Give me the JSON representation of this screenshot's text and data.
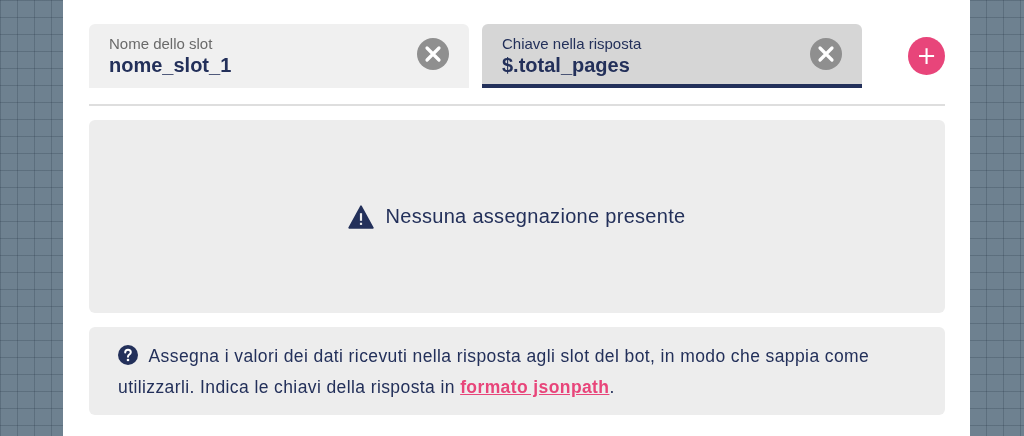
{
  "fields": [
    {
      "label": "Nome dello slot",
      "value": "nome_slot_1",
      "focused": false
    },
    {
      "label": "Chiave nella risposta",
      "value": "$.total_pages",
      "focused": true
    }
  ],
  "add_button": {
    "label": "+"
  },
  "empty_state": {
    "message": "Nessuna assegnazione presente"
  },
  "info": {
    "text_before": "Assegna i valori dei dati ricevuti nella risposta agli slot del bot, in modo che sappia come utilizzarli. Indica le chiavi della risposta in ",
    "link": "formato jsonpath",
    "text_after": "."
  }
}
